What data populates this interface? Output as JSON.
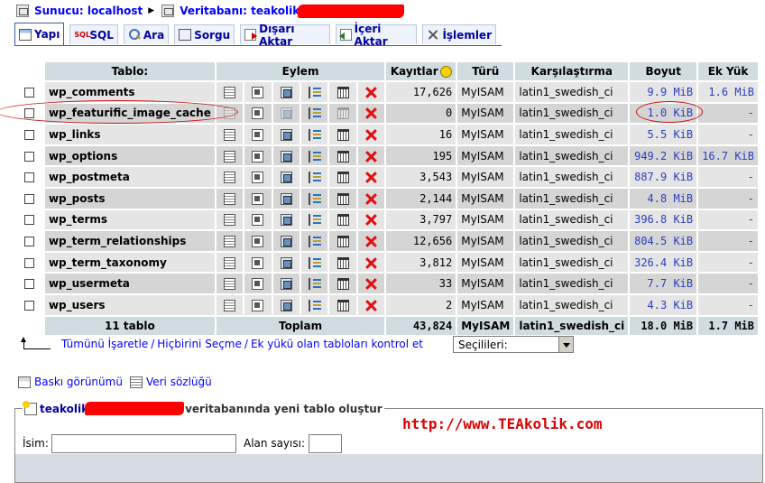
{
  "breadcrumb": {
    "server_label": "Sunucu: localhost",
    "database_label": "Veritabanı: teakolik"
  },
  "tabs": [
    {
      "label": "Yapı",
      "icon": "structure-icon",
      "active": true
    },
    {
      "label": "SQL",
      "icon": "sql-icon"
    },
    {
      "label": "Ara",
      "icon": "search-icon"
    },
    {
      "label": "Sorgu",
      "icon": "query-icon"
    },
    {
      "label": "Dışarı Aktar",
      "icon": "export-icon"
    },
    {
      "label": "İçeri Aktar",
      "icon": "import-icon"
    },
    {
      "label": "İşlemler",
      "icon": "operations-icon"
    }
  ],
  "table": {
    "headers": {
      "table": "Tablo:",
      "action": "Eylem",
      "records": "Kayıtlar",
      "type": "Türü",
      "collation": "Karşılaştırma",
      "size": "Boyut",
      "overhead": "Ek Yük"
    },
    "rows": [
      {
        "name": "wp_comments",
        "records": "17,626",
        "type": "MyISAM",
        "collation": "latin1_swedish_ci",
        "size": "9.9 MiB",
        "overhead": "1.6 MiB"
      },
      {
        "name": "wp_featurific_image_cache",
        "records": "0",
        "type": "MyISAM",
        "collation": "latin1_swedish_ci",
        "size": "1.0 KiB",
        "overhead": "-"
      },
      {
        "name": "wp_links",
        "records": "16",
        "type": "MyISAM",
        "collation": "latin1_swedish_ci",
        "size": "5.5 KiB",
        "overhead": "-"
      },
      {
        "name": "wp_options",
        "records": "195",
        "type": "MyISAM",
        "collation": "latin1_swedish_ci",
        "size": "949.2 KiB",
        "overhead": "16.7 KiB"
      },
      {
        "name": "wp_postmeta",
        "records": "3,543",
        "type": "MyISAM",
        "collation": "latin1_swedish_ci",
        "size": "887.9 KiB",
        "overhead": "-"
      },
      {
        "name": "wp_posts",
        "records": "2,144",
        "type": "MyISAM",
        "collation": "latin1_swedish_ci",
        "size": "4.8 MiB",
        "overhead": "-"
      },
      {
        "name": "wp_terms",
        "records": "3,797",
        "type": "MyISAM",
        "collation": "latin1_swedish_ci",
        "size": "396.8 KiB",
        "overhead": "-"
      },
      {
        "name": "wp_term_relationships",
        "records": "12,656",
        "type": "MyISAM",
        "collation": "latin1_swedish_ci",
        "size": "804.5 KiB",
        "overhead": "-"
      },
      {
        "name": "wp_term_taxonomy",
        "records": "3,812",
        "type": "MyISAM",
        "collation": "latin1_swedish_ci",
        "size": "326.4 KiB",
        "overhead": "-"
      },
      {
        "name": "wp_usermeta",
        "records": "33",
        "type": "MyISAM",
        "collation": "latin1_swedish_ci",
        "size": "7.7 KiB",
        "overhead": "-"
      },
      {
        "name": "wp_users",
        "records": "2",
        "type": "MyISAM",
        "collation": "latin1_swedish_ci",
        "size": "4.3 KiB",
        "overhead": "-"
      }
    ],
    "footer": {
      "count": "11 tablo",
      "total_label": "Toplam",
      "records": "43,824",
      "type": "MyISAM",
      "collation": "latin1_swedish_ci",
      "size": "18.0 MiB",
      "overhead": "1.7 MiB"
    }
  },
  "bulk": {
    "check_all": "Tümünü İşaretle",
    "uncheck_all": "Hiçbirini Seçme",
    "check_overhead": "Ek yükü olan tabloları kontrol et",
    "separator": "/",
    "select_value": "Seçilileri:"
  },
  "links": {
    "print_view": "Baskı görünümü",
    "data_dictionary": "Veri sözlüğü"
  },
  "create_table": {
    "db_name": "teakolik",
    "legend_suffix": "veritabanında yeni tablo oluştur",
    "name_label": "İsim:",
    "fields_label": "Alan sayısı:"
  },
  "watermark": "http://www.TEAkolik.com"
}
